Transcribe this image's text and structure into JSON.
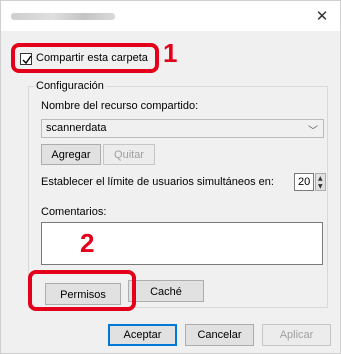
{
  "window": {
    "close_glyph": "✕"
  },
  "share": {
    "checked": true,
    "label": "Compartir esta carpeta"
  },
  "config": {
    "legend": "Configuración",
    "share_name_label": "Nombre del recurso compartido:",
    "share_name_value": "scannerdata",
    "add_button": "Agregar",
    "remove_button": "Quitar",
    "user_limit_label": "Establecer el límite de usuarios simultáneos en:",
    "user_limit_value": "20",
    "comments_label": "Comentarios:",
    "comments_value": "",
    "permissions_button": "Permisos",
    "cache_button": "Caché"
  },
  "footer": {
    "ok_button": "Aceptar",
    "cancel_button": "Cancelar",
    "apply_button": "Aplicar"
  },
  "annotations": {
    "step1": "1",
    "step2": "2",
    "color": "#e4001b"
  }
}
